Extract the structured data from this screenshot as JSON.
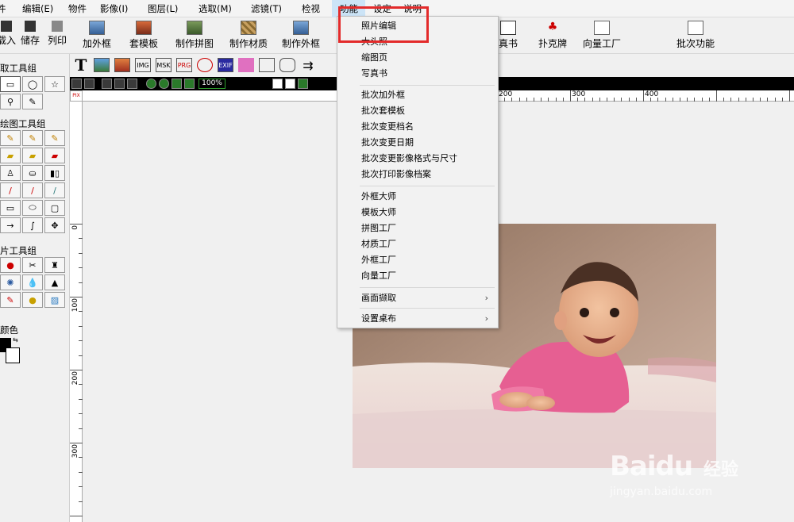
{
  "menubar": {
    "items": [
      "件",
      "编辑(E)",
      "物件",
      "影像(I)",
      "图层(L)",
      "选取(M)",
      "滤镜(T)",
      "检视",
      "功能",
      "设定",
      "说明"
    ]
  },
  "toolbar": {
    "buttons": [
      "载入",
      "储存",
      "列印",
      "加外框",
      "套模板",
      "制作拼图",
      "制作材质",
      "制作外框",
      "真书",
      "扑克牌",
      "向量工厂",
      "批次功能"
    ]
  },
  "iconbar": {
    "items": [
      "T",
      "",
      "",
      "IMG",
      "MSK",
      "PRG",
      "",
      "EXIF",
      "",
      "",
      "",
      ""
    ]
  },
  "navstrip": {
    "zoom": "100%"
  },
  "palette": {
    "groups": [
      {
        "title": "取工具组"
      },
      {
        "title": "绘图工具组"
      },
      {
        "title": "片工具组"
      },
      {
        "title": "颜色"
      }
    ]
  },
  "rulers": {
    "h_labels": [
      "200",
      "300",
      "400"
    ],
    "v_labels": [
      "0",
      "100",
      "200",
      "300"
    ],
    "corner": "PIX"
  },
  "dropdown": {
    "items": [
      {
        "label": "照片编辑"
      },
      {
        "label": "大头照"
      },
      {
        "label": "缩图页"
      },
      {
        "label": "写真书"
      },
      {
        "label": "批次加外框"
      },
      {
        "label": "批次套模板"
      },
      {
        "label": "批次变更档名"
      },
      {
        "label": "批次变更日期"
      },
      {
        "label": "批次变更影像格式与尺寸"
      },
      {
        "label": "批次打印影像档案"
      },
      {
        "label": "外框大师"
      },
      {
        "label": "模板大师"
      },
      {
        "label": "拼图工厂"
      },
      {
        "label": "材质工厂"
      },
      {
        "label": "外框工厂"
      },
      {
        "label": "向量工厂"
      },
      {
        "label": "画面撷取",
        "submenu": true
      },
      {
        "label": "设置桌布",
        "submenu": true
      }
    ]
  },
  "watermark": {
    "brand": "Baidu",
    "brand_cn": "经验",
    "url": "jingyan.baidu.com"
  },
  "colors": {
    "highlight": "#e32b2b",
    "menu_active": "#cce4f7"
  }
}
